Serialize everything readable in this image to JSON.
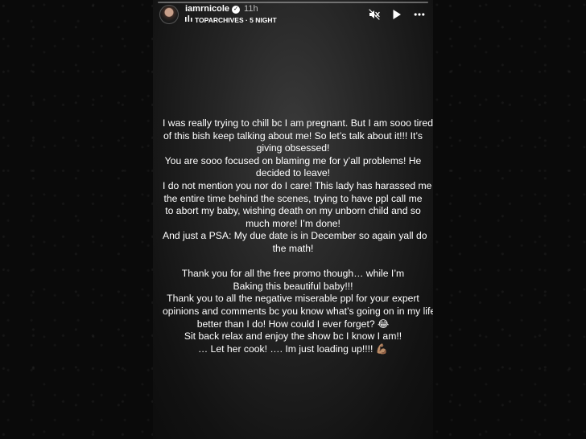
{
  "header": {
    "username": "iamrnicole",
    "verified_mark": "✓",
    "time_ago": "11h",
    "subtitle": "TOPARCHIVES · 5 NIGHT"
  },
  "icons": {
    "verified": "verified-badge-icon",
    "music": "music-bars-icon",
    "mute": "speaker-muted-icon",
    "play": "play-icon",
    "more": "more-horizontal-icon"
  },
  "story": {
    "lines": [
      "I was really trying to chill bc I am pregnant. But I am sooo tired",
      "of this bish keep talking about me! So let’s talk about it!!! It’s",
      "giving obsessed!",
      "You are sooo focused on blaming me for y’all problems! He",
      "decided to leave!",
      "I do not mention you nor do I care!  This lady has harassed me",
      "the entire time behind the scenes, trying to have ppl call me",
      "to abort my baby, wishing death on my unborn child and so",
      "much more! I’m done!",
      "And just a PSA: My due date is in December so again yall do",
      "the math!",
      "",
      "Thank you for all the free promo though… while I’m",
      "Baking this beautiful baby!!!",
      "Thank you to all the negative miserable ppl for your expert",
      "opinions and comments bc you know what’s going on in my life",
      "better than I do! How could I ever forget? 😂",
      "Sit back relax and enjoy the show bc I know I am!!",
      "… Let her cook! …. Im just loading up!!!! 💪🏽"
    ]
  }
}
